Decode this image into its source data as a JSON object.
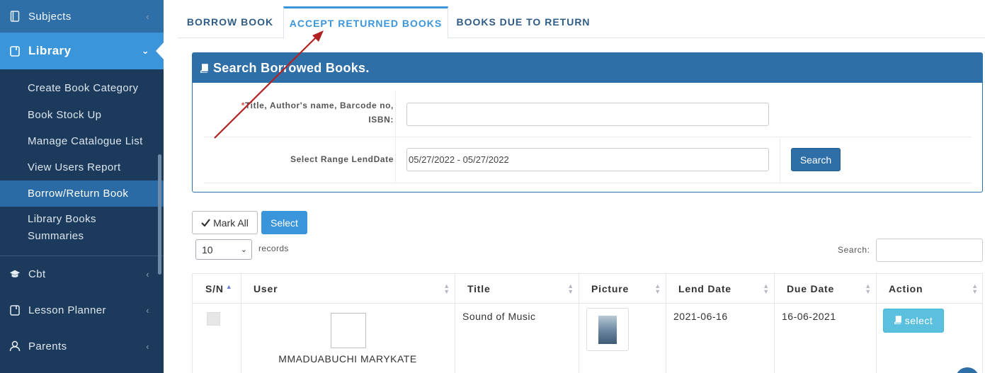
{
  "sidebar": {
    "subjects": "Subjects",
    "library": "Library",
    "library_items": [
      {
        "label": "Create Book Category"
      },
      {
        "label": "Book Stock Up"
      },
      {
        "label": "Manage Catalogue List"
      },
      {
        "label": "View Users Report"
      },
      {
        "label": "Borrow/Return Book"
      },
      {
        "label": "Library Books Summaries"
      }
    ],
    "cbt": "Cbt",
    "lesson_planner": "Lesson Planner",
    "parents": "Parents"
  },
  "tabs": [
    {
      "label": "BORROW BOOK"
    },
    {
      "label": "ACCEPT RETURNED BOOKS"
    },
    {
      "label": "BOOKS DUE TO RETURN"
    }
  ],
  "search_panel": {
    "title": "Search Borrowed Books.",
    "field1_required_mark": "*",
    "field1_label_line1": "Title, Author's name, Barcode no,",
    "field1_label_line2": "ISBN:",
    "field1_value": "",
    "field2_label": "Select Range LendDate",
    "field2_value": "05/27/2022 - 05/27/2022",
    "search_button": "Search"
  },
  "toolbar": {
    "mark_all": "Mark All",
    "select": "Select",
    "page_length": "10",
    "records_label": "records",
    "search_label": "Search:",
    "search_value": ""
  },
  "table": {
    "headers": [
      "S/N",
      "User",
      "Title",
      "Picture",
      "Lend Date",
      "Due Date",
      "Action"
    ],
    "rows": [
      {
        "user": "MMADUABUCHI MARYKATE",
        "title": "Sound of Music",
        "lend_date": "2021-06-16",
        "due_date": "16-06-2021",
        "action": "select"
      }
    ]
  },
  "colors": {
    "sidebar_bg": "#1b3a5c",
    "accent": "#3a95db",
    "panel_blue": "#2f6fa8",
    "info_button": "#5bc0de",
    "annotation_arrow": "#b22222"
  }
}
